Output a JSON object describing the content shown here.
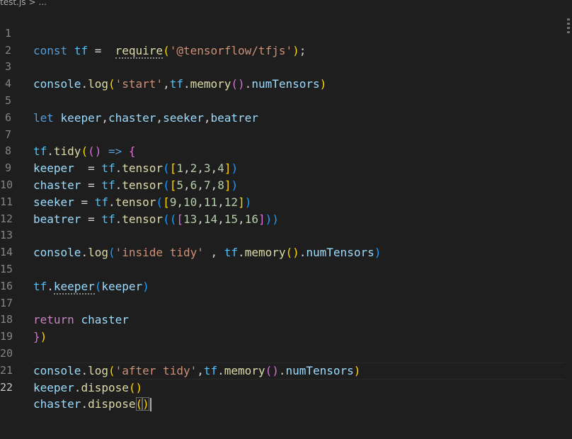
{
  "breadcrumb": {
    "file": "test.js",
    "separator": ">",
    "symbol": "..."
  },
  "colors": {
    "background": "#1e1e1e",
    "keyword": "#569cd6",
    "control": "#c586c0",
    "variable": "#9cdcfe",
    "function": "#dcdcaa",
    "string": "#ce9178",
    "number": "#b5cea8"
  },
  "editor": {
    "line_numbers": [
      "1",
      "2",
      "3",
      "4",
      "5",
      "6",
      "7",
      "8",
      "9",
      "10",
      "11",
      "12",
      "13",
      "14",
      "15",
      "16",
      "17",
      "18",
      "19",
      "20",
      "21",
      "22"
    ],
    "current_line": "22",
    "tokens": {
      "l1": [
        "const",
        "tf",
        "=",
        "require",
        "(",
        "'@tensorflow/tfjs'",
        ")",
        ";"
      ],
      "l3": [
        "console",
        ".",
        "log",
        "(",
        "'start'",
        ",",
        "tf",
        ".",
        "memory",
        "()",
        ".",
        "numTensors",
        ")"
      ],
      "l5": [
        "let",
        "keeper",
        ",",
        "chaster",
        ",",
        "seeker",
        ",",
        "beatrer"
      ],
      "l7": [
        "tf",
        ".",
        "tidy",
        "(",
        "()",
        "=>",
        "{"
      ],
      "l8": [
        "keeper",
        "=",
        "tf",
        ".",
        "tensor",
        "(",
        "[",
        "1",
        ",",
        "2",
        ",",
        "3",
        ",",
        "4",
        "]",
        ")"
      ],
      "l9": [
        "chaster",
        "=",
        "tf",
        ".",
        "tensor",
        "(",
        "[",
        "5",
        ",",
        "6",
        ",",
        "7",
        ",",
        "8",
        "]",
        ")"
      ],
      "l10": [
        "seeker",
        "=",
        "tf",
        ".",
        "tensor",
        "(",
        "[",
        "9",
        ",",
        "10",
        ",",
        "11",
        ",",
        "12",
        "]",
        ")"
      ],
      "l11": [
        "beatrer",
        "=",
        "tf",
        ".",
        "tensor",
        "((",
        "[",
        "13",
        ",",
        "14",
        ",",
        "15",
        ",",
        "16",
        "]",
        "))"
      ],
      "l13": [
        "console",
        ".",
        "log",
        "(",
        "'inside tidy'",
        ",",
        "tf",
        ".",
        "memory",
        "()",
        ".",
        "numTensors",
        ")"
      ],
      "l15": [
        "tf",
        ".",
        "keeper",
        "(",
        "keeper",
        ")"
      ],
      "l17": [
        "return",
        "chaster"
      ],
      "l18": [
        "}",
        ")"
      ],
      "l20": [
        "console",
        ".",
        "log",
        "(",
        "'after tidy'",
        ",",
        "tf",
        ".",
        "memory",
        "()",
        ".",
        "numTensors",
        ")"
      ],
      "l21": [
        "keeper",
        ".",
        "dispose",
        "()"
      ],
      "l22": [
        "chaster",
        ".",
        "dispose",
        "(",
        ")"
      ]
    }
  }
}
